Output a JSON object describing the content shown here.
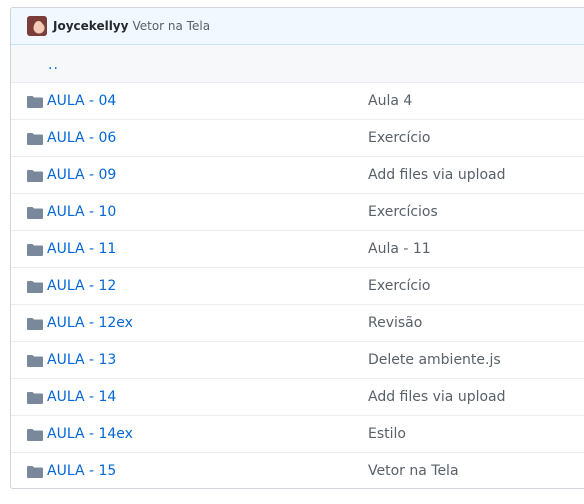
{
  "commit": {
    "author": "Joycekellyy",
    "message": "Vetor na Tela"
  },
  "parent_link": "..",
  "folder_icon": "folder-icon",
  "colors": {
    "link": "#0366d6",
    "folder": "#79889b",
    "text_muted": "#586069",
    "header_bg": "#f1f8ff"
  },
  "rows": [
    {
      "name": "AULA - 04",
      "message": "Aula 4"
    },
    {
      "name": "AULA - 06",
      "message": "Exercício"
    },
    {
      "name": "AULA - 09",
      "message": "Add files via upload"
    },
    {
      "name": "AULA - 10",
      "message": "Exercícios"
    },
    {
      "name": "AULA - 11",
      "message": "Aula - 11"
    },
    {
      "name": "AULA - 12",
      "message": "Exercício"
    },
    {
      "name": "AULA - 12ex",
      "message": "Revisão"
    },
    {
      "name": "AULA - 13",
      "message": "Delete ambiente.js"
    },
    {
      "name": "AULA - 14",
      "message": "Add files via upload"
    },
    {
      "name": "AULA - 14ex",
      "message": "Estilo"
    },
    {
      "name": "AULA - 15",
      "message": "Vetor na Tela"
    }
  ]
}
